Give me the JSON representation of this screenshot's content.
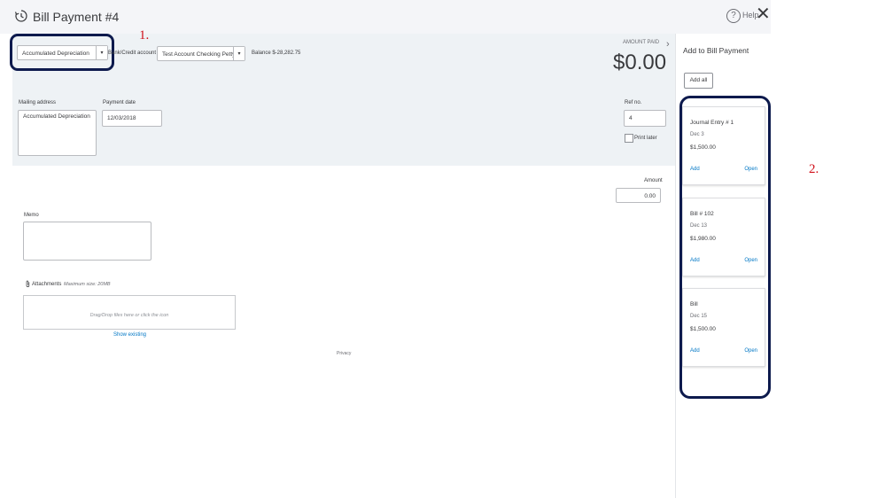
{
  "header": {
    "title": "Bill Payment #4",
    "help_label": "Help",
    "close_glyph": "✕"
  },
  "payee": {
    "value": "Accumulated Depreciation"
  },
  "bank_account": {
    "label": "Bank/Credit account",
    "value": "Test Account Checking Petty Cash",
    "balance": "Balance $-28,282.75"
  },
  "amount_paid": {
    "label": "AMOUNT PAID",
    "value": "$0.00"
  },
  "mailing_address": {
    "label": "Mailing address",
    "value": "Accumulated Depreciation"
  },
  "payment_date": {
    "label": "Payment date",
    "value": "12/03/2018"
  },
  "ref_no": {
    "label": "Ref no.",
    "value": "4"
  },
  "print_later": {
    "label": "Print later"
  },
  "amount": {
    "label": "Amount",
    "value": "0.00"
  },
  "memo": {
    "label": "Memo"
  },
  "attachments": {
    "label": "Attachments",
    "max_size": "Maximum size: 20MB",
    "drop_text": "Drag/Drop files here or click the icon",
    "show_existing": "Show existing"
  },
  "footer": {
    "privacy": "Privacy"
  },
  "side_panel": {
    "title": "Add to Bill Payment",
    "add_all": "Add all",
    "items": [
      {
        "title": "Journal Entry # 1",
        "date": "Dec 3",
        "amount": "$1,500.00",
        "add": "Add",
        "open": "Open"
      },
      {
        "title": "Bill # 102",
        "date": "Dec 13",
        "amount": "$1,980.00",
        "add": "Add",
        "open": "Open"
      },
      {
        "title": "Bill",
        "date": "Dec 15",
        "amount": "$1,500.00",
        "add": "Add",
        "open": "Open"
      }
    ]
  },
  "annotations": {
    "one": "1.",
    "two": "2."
  },
  "colors": {
    "annotation_outline": "#0d1a4d",
    "annotation_number": "#d0101a",
    "link": "#0077c5"
  }
}
